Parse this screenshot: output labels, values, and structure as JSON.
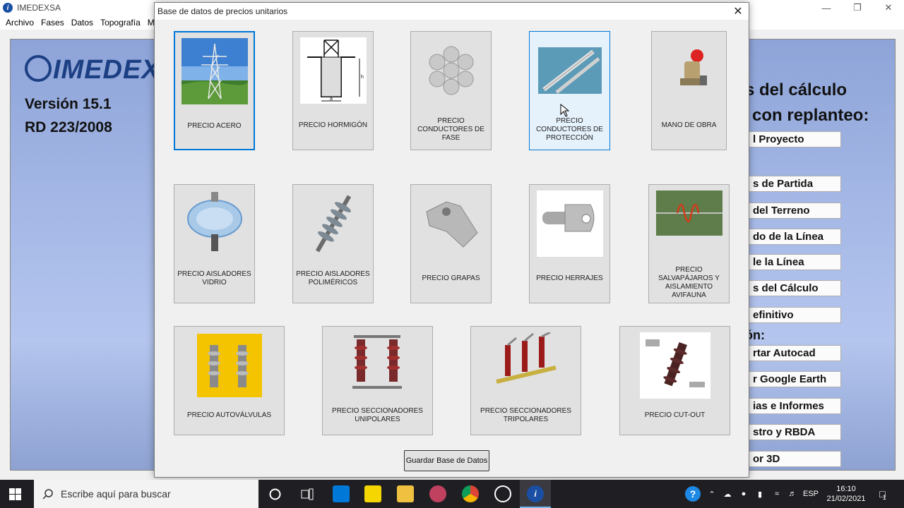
{
  "app": {
    "title": "IMEDEXSA",
    "menu": [
      "Archivo",
      "Fases",
      "Datos",
      "Topografía",
      "M"
    ],
    "logo": "IMEDEXSA",
    "version_line": "Versión 15.1",
    "rd_line": "RD 223/2008",
    "heading_1": "s del cálculo",
    "heading_2": "a con replanteo:",
    "subheading": "ón:",
    "side_buttons": [
      "l Proyecto",
      "s de Partida",
      "del Terreno",
      "do de la Línea",
      "le la Línea",
      "s del Cálculo",
      "efinitivo",
      "rtar Autocad",
      "r Google Earth",
      "ias e Informes",
      "stro y RBDA",
      "or 3D"
    ]
  },
  "dialog": {
    "title": "Base de datos de precios unitarios",
    "close_icon": "close-icon",
    "tiles": [
      {
        "label": "PRECIO ACERO",
        "icon": "steel-tower-icon"
      },
      {
        "label": "PRECIO HORMIGÓN",
        "icon": "concrete-foundation-icon"
      },
      {
        "label": "PRECIO CONDUCTORES DE FASE",
        "icon": "phase-conductor-icon"
      },
      {
        "label": "PRECIO CONDUCTORES DE PROTECCIÓN",
        "icon": "protection-conductor-icon"
      },
      {
        "label": "MANO DE OBRA",
        "icon": "worker-icon"
      },
      {
        "label": "PRECIO AISLADORES VIDRIO",
        "icon": "glass-insulator-icon"
      },
      {
        "label": "PRECIO AISLADORES POLIMÉRICOS",
        "icon": "polymer-insulator-icon"
      },
      {
        "label": "PRECIO GRAPAS",
        "icon": "clamp-icon"
      },
      {
        "label": "PRECIO HERRAJES",
        "icon": "hardware-fitting-icon"
      },
      {
        "label": "PRECIO SALVAPÁJAROS Y AISLAMIENTO AVIFAUNA",
        "icon": "bird-diverter-icon"
      },
      {
        "label": "PRECIO AUTOVÁLVULAS",
        "icon": "surge-arrester-icon"
      },
      {
        "label": "PRECIO SECCIONADORES UNIPOLARES",
        "icon": "single-pole-disconnector-icon"
      },
      {
        "label": "PRECIO SECCIONADORES TRIPOLARES",
        "icon": "three-pole-disconnector-icon"
      },
      {
        "label": "PRECIO CUT-OUT",
        "icon": "cut-out-fuse-icon"
      }
    ],
    "save_label": "Guardar Base de Datos"
  },
  "taskbar": {
    "search_placeholder": "Escribe aquí para buscar",
    "language": "ESP",
    "time": "16:10",
    "date": "21/02/2021",
    "notification_count": "1"
  }
}
